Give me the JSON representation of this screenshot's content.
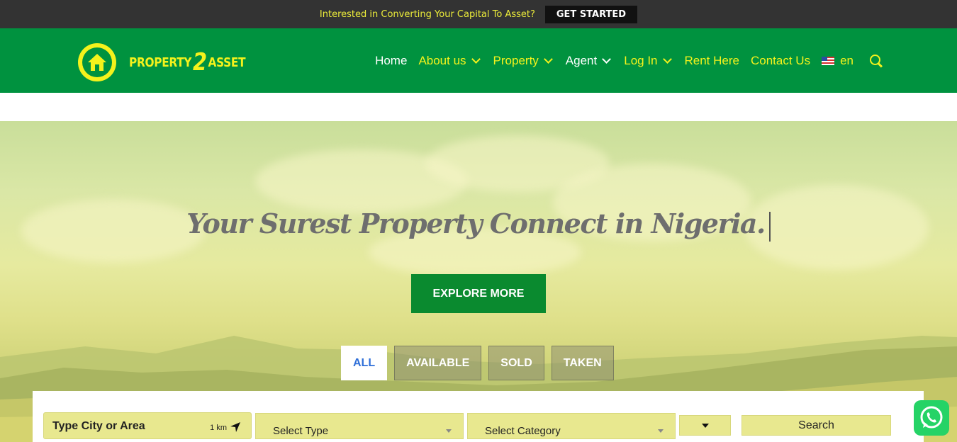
{
  "topbar": {
    "message": "Interested in Converting Your Capital To Asset?",
    "cta_label": "GET STARTED"
  },
  "logo": {
    "word1": "PROPERTY",
    "numeral": "2",
    "word2": "ASSET",
    "icon": "house-icon"
  },
  "nav": {
    "items": [
      {
        "label": "Home",
        "dropdown": false
      },
      {
        "label": "About us",
        "dropdown": true
      },
      {
        "label": "Property",
        "dropdown": true
      },
      {
        "label": "Agent",
        "dropdown": true
      },
      {
        "label": "Log In",
        "dropdown": true
      },
      {
        "label": "Rent Here",
        "dropdown": false
      },
      {
        "label": "Contact Us",
        "dropdown": false
      }
    ],
    "language": "en",
    "language_flag": "us-flag-icon",
    "search_icon": "search-icon"
  },
  "hero": {
    "headline": "Your Surest Property Connect in Nigeria.",
    "explore_label": "EXPLORE MORE",
    "tabs": [
      {
        "label": "ALL",
        "active": true
      },
      {
        "label": "AVAILABLE",
        "active": false
      },
      {
        "label": "SOLD",
        "active": false
      },
      {
        "label": "TAKEN",
        "active": false
      }
    ]
  },
  "search": {
    "city_placeholder": "Type City or Area",
    "radius": "1 km",
    "type_placeholder": "Select Type",
    "category_placeholder": "Select Category",
    "search_label": "Search"
  },
  "colors": {
    "topbar_bg": "#333333",
    "header_bg": "#00923f",
    "accent_yellow": "#f4f21c",
    "explore_bg": "#0a8a2f",
    "field_bg": "#e8e88f",
    "whatsapp": "#25d366"
  }
}
